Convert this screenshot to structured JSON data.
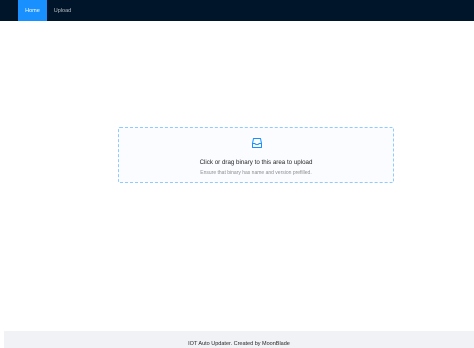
{
  "nav": {
    "items": [
      {
        "label": "Home",
        "active": true
      },
      {
        "label": "Upload",
        "active": false
      }
    ],
    "background": "#001529",
    "active_color": "#1890ff"
  },
  "upload": {
    "icon": "inbox-icon",
    "text": "Click or drag binary to this area to upload",
    "hint": "Ensure that binary has name and version prefilled."
  },
  "footer": {
    "text": "IOT Auto Updater. Created by MoonBlade"
  }
}
